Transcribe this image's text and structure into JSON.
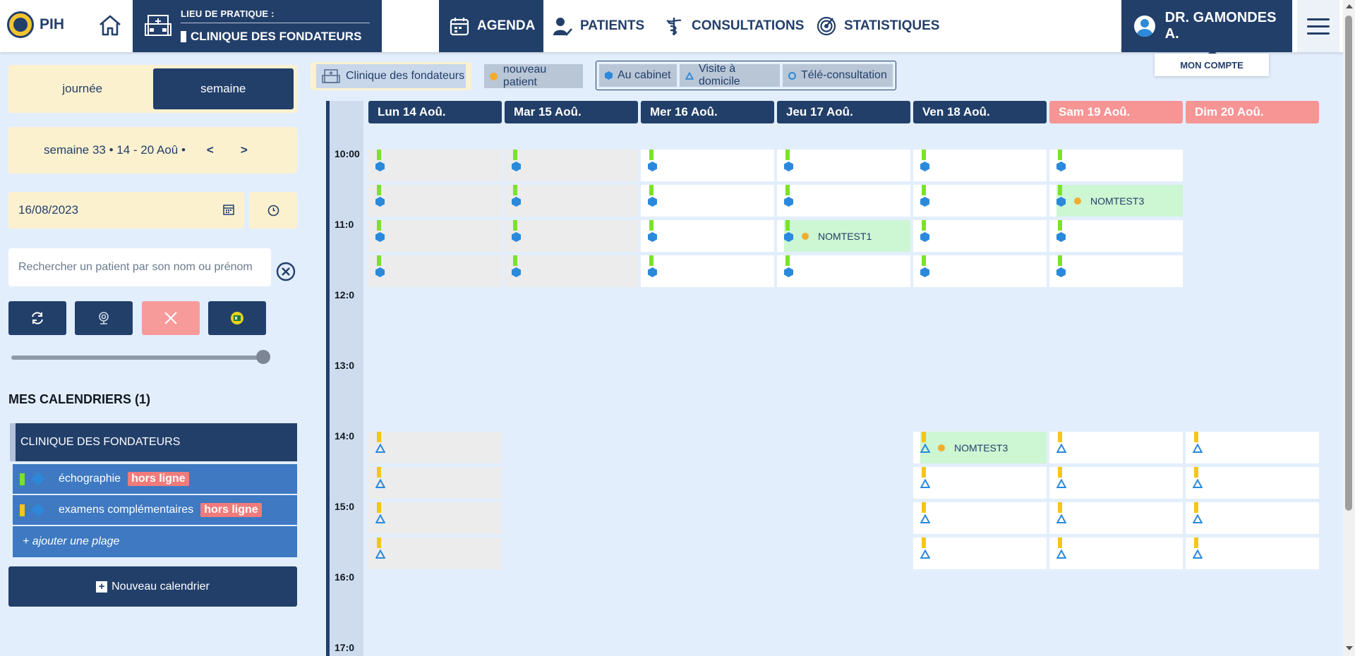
{
  "app": {
    "name": "PIH"
  },
  "lieu": {
    "label": "LIEU DE PRATIQUE :",
    "value": "CLINIQUE DES FONDATEURS"
  },
  "nav": {
    "agenda": "AGENDA",
    "patients": "PATIENTS",
    "consultations": "CONSULTATIONS",
    "statistiques": "STATISTIQUES"
  },
  "account": {
    "name": "DR. GAMONDES A.",
    "menu": "MON COMPTE"
  },
  "sidebar": {
    "view_day": "journée",
    "view_week": "semaine",
    "week_text": "semaine 33 • 14 - 20 Aoû •",
    "prev": "<",
    "next": ">",
    "date_value": "16/08/2023",
    "search_placeholder": "Rechercher un patient par son nom ou prénom",
    "calendars_title": "MES CALENDRIERS (1)",
    "calendar_name": "CLINIQUE DES FONDATEURS",
    "plages": [
      {
        "label": "échographie",
        "badge": "hors ligne",
        "color": "#7be22a"
      },
      {
        "label": "examens complémentaires",
        "badge": "hors ligne",
        "color": "#f5c518"
      }
    ],
    "add_plage": "+ ajouter une plage",
    "new_calendar": "Nouveau calendrier"
  },
  "filters": {
    "clinic": "Clinique des fondateurs",
    "new_patient": "nouveau patient",
    "cabinet": "Au cabinet",
    "domicile": "Visite à domicile",
    "tele": "Télé-consultation"
  },
  "calendar": {
    "days": [
      "Lun 14 Aoû.",
      "Mar 15 Aoû.",
      "Mer 16 Aoû.",
      "Jeu 17 Aoû.",
      "Ven 18 Aoû.",
      "Sam 19 Aoû.",
      "Dim 20 Aoû."
    ],
    "hours": [
      "10:00",
      "11:0",
      "12:0",
      "13:0",
      "14:0",
      "15:0",
      "16:0",
      "17:0"
    ],
    "appointments": [
      {
        "day": "Jeu 17 Aoû.",
        "name": "NOMTEST1"
      },
      {
        "day": "Sam 19 Aoû.",
        "name": "NOMTEST3"
      },
      {
        "day": "Ven 18 Aoû.",
        "name": "NOMTEST3"
      }
    ]
  },
  "colors": {
    "primary": "#223f6a",
    "accent_yellow": "#fcf1cf",
    "weekend": "#f79494",
    "echographie": "#7be22a",
    "examens": "#f5c518",
    "appointment": "#cdf6d3"
  }
}
